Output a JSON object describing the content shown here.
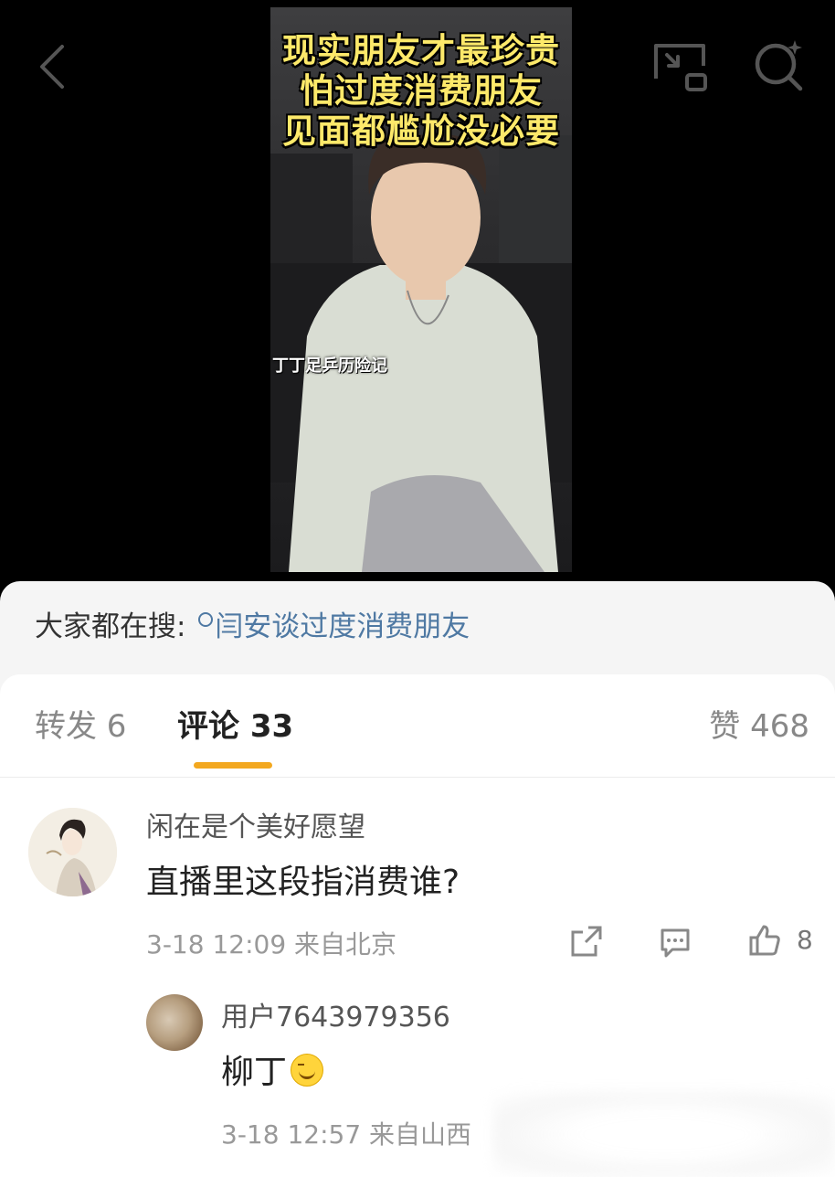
{
  "video": {
    "caption_lines": [
      "现实朋友才最珍贵",
      "怕过度消费朋友",
      "见面都尴尬没必要"
    ],
    "watermark": "丁丁足乒历险记"
  },
  "top_bar": {
    "icons": [
      "back-arrow-icon",
      "picture-in-picture-icon",
      "search-sparkle-icon"
    ]
  },
  "hot_search": {
    "label": "大家都在搜:",
    "query": "闫安谈过度消费朋友"
  },
  "tabs": {
    "forward": "转发 6",
    "comment": "评论 33",
    "like": "赞 468",
    "accent_color": "#f3a81f"
  },
  "comments": [
    {
      "username": "闲在是个美好愿望",
      "text": "直播里这段指消费谁?",
      "time": "3-18 12:09",
      "location": "来自北京",
      "like_count": "8"
    }
  ],
  "reply": {
    "username": "用户7643979356",
    "text": "柳丁",
    "emoji": "grinning-face-emoji",
    "time": "3-18 12:57",
    "location": "来自山西"
  }
}
